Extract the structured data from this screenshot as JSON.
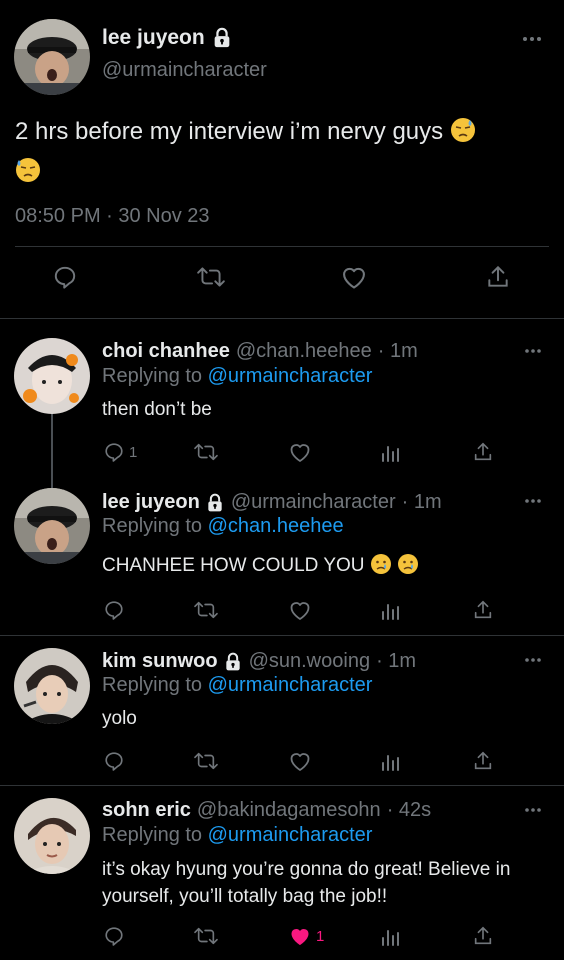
{
  "main_tweet": {
    "name": "lee juyeon",
    "handle": "@urmaincharacter",
    "text": "2 hrs before my interview i’m nervy guys",
    "timestamp": "08:50 PM · 30 Nov 23",
    "icons": [
      "lock-icon",
      "more-icon",
      "reply-icon",
      "retweet-icon",
      "like-icon",
      "share-icon"
    ]
  },
  "replying_label": "Replying to",
  "replies": [
    {
      "name": "choi chanhee",
      "handle": "@chan.heehee",
      "time": "· 1m",
      "replying_to": "@urmaincharacter",
      "text": "then don’t be",
      "reply_count": "1",
      "like_count": ""
    },
    {
      "name": "lee juyeon",
      "handle": "@urmaincharacter",
      "time": "· 1m",
      "replying_to": "@chan.heehee",
      "text": "CHANHEE HOW COULD YOU",
      "reply_count": "",
      "like_count": ""
    },
    {
      "name": "kim sunwoo",
      "handle": "@sun.wooing",
      "time": "· 1m",
      "replying_to": "@urmaincharacter",
      "text": "yolo",
      "reply_count": "",
      "like_count": ""
    },
    {
      "name": "sohn eric",
      "handle": "@bakindagamesohn",
      "time": "· 42s",
      "replying_to": "@urmaincharacter",
      "text": "it’s okay hyung you’re gonna do great! Believe in yourself, you’ll totally bag the job!!",
      "reply_count": "",
      "like_count": "1",
      "liked": true
    }
  ],
  "colors": {
    "background": "#000000",
    "text": "#e7e9ea",
    "muted": "#71767b",
    "link": "#1d9bf0",
    "like": "#f91880"
  }
}
